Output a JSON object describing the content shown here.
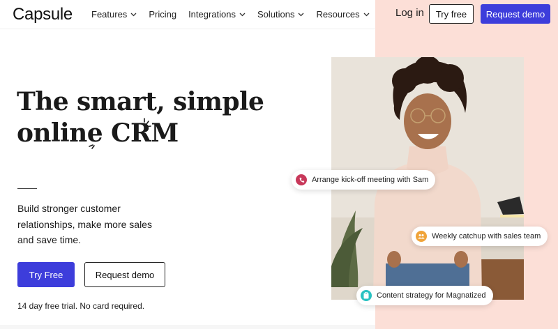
{
  "header": {
    "logo": "Capsule",
    "nav": [
      {
        "label": "Features",
        "dropdown": true
      },
      {
        "label": "Pricing",
        "dropdown": false
      },
      {
        "label": "Integrations",
        "dropdown": true
      },
      {
        "label": "Solutions",
        "dropdown": true
      },
      {
        "label": "Resources",
        "dropdown": true
      }
    ],
    "login": "Log in",
    "try_free": "Try free",
    "request_demo": "Request demo"
  },
  "hero": {
    "headline_line1": "The smart, simple",
    "headline_line2_prefix": "online ",
    "headline_line2_emphasis": "CRM",
    "subtext": "Build stronger customer relationships, make more sales and save time.",
    "primary_cta": "Try Free",
    "secondary_cta": "Request demo",
    "trial_note": "14 day free trial. No card required."
  },
  "chips": [
    {
      "label": "Arrange kick-off meeting with Sam",
      "icon": "phone-icon",
      "color": "#c8385a"
    },
    {
      "label": "Weekly catchup with sales team",
      "icon": "team-icon",
      "color": "#f0a43a"
    },
    {
      "label": "Content strategy for Magnatized",
      "icon": "clipboard-icon",
      "color": "#29c2c2"
    }
  ],
  "colors": {
    "brand": "#3d3ddb",
    "peach": "#fcdfd7"
  }
}
